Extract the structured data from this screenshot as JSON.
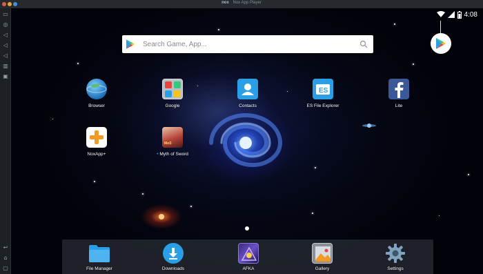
{
  "window": {
    "logo": "nox",
    "title": "Nox App Player",
    "controls": [
      {
        "name": "close",
        "color": "#e25c4b"
      },
      {
        "name": "minimize",
        "color": "#e2a43b"
      },
      {
        "name": "maximize",
        "color": "#4a90d9"
      }
    ]
  },
  "sidebar": {
    "top_tools": [
      "screen-icon",
      "location-icon",
      "volume-up-icon",
      "volume-down-icon",
      "volume-mute-icon",
      "chart-icon",
      "screenshot-icon"
    ],
    "bottom_tools": [
      "back-icon",
      "home-icon",
      "recents-icon"
    ]
  },
  "status_bar": {
    "time": "4:08",
    "icons": [
      "wifi-icon",
      "signal-icon",
      "battery-icon"
    ]
  },
  "search": {
    "placeholder": "Search Game, App..."
  },
  "apps": [
    {
      "label": "Browser",
      "icon": "globe-icon"
    },
    {
      "label": "Google",
      "icon": "folder-icon"
    },
    {
      "label": "Contacts",
      "icon": "contacts-icon"
    },
    {
      "label": "ES File Explorer",
      "icon": "es-file-icon"
    },
    {
      "label": "Lite",
      "icon": "facebook-icon"
    },
    {
      "label": "NoxApp+",
      "icon": "plus-icon"
    },
    {
      "label": "Myth of Sword",
      "icon": "game-icon",
      "new_badge": true
    }
  ],
  "dock": [
    {
      "label": "File Manager",
      "icon": "folder-icon"
    },
    {
      "label": "Downloads",
      "icon": "download-icon"
    },
    {
      "label": "AFKA",
      "icon": "afka-icon"
    },
    {
      "label": "Gallery",
      "icon": "gallery-icon"
    },
    {
      "label": "Settings",
      "icon": "gear-icon"
    }
  ],
  "colors": {
    "accent_blue": "#2b9fe6",
    "facebook_blue": "#3b5998",
    "nox_orange": "#f39a24"
  }
}
